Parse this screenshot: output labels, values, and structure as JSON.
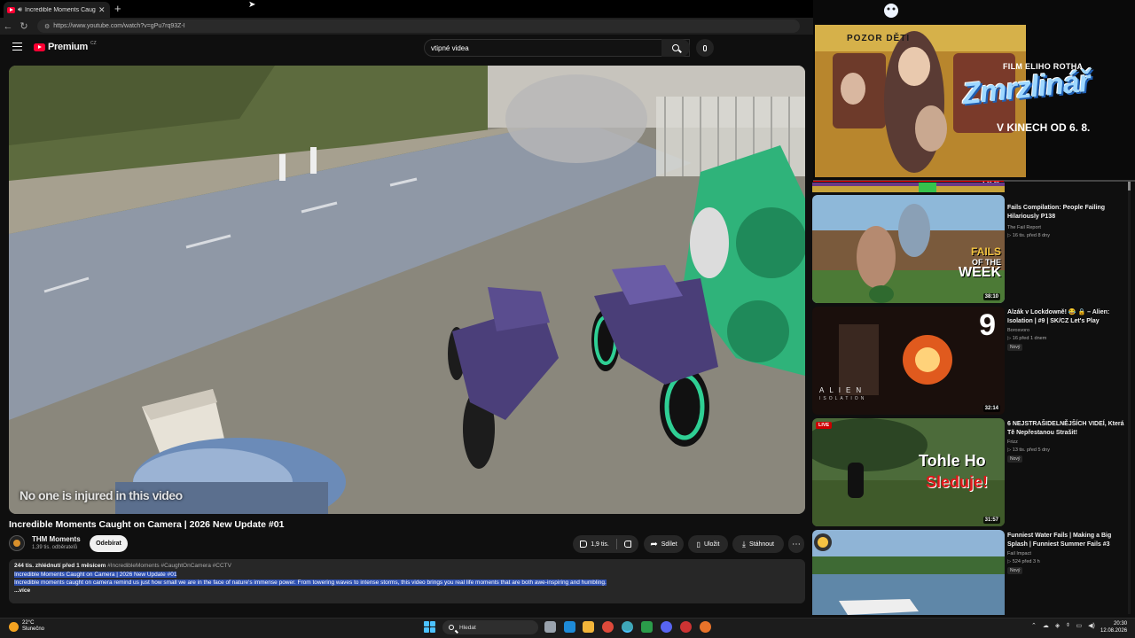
{
  "browser": {
    "tab_title": "Incredible Moments Caught on Camera",
    "new_tab_label": "+",
    "url": "https://www.youtube.com/watch?v=gPu7rq93Z-I"
  },
  "youtube": {
    "logo_text": "Premium",
    "logo_superscript": "CZ",
    "search_value": "vtipné videa"
  },
  "video": {
    "caption": "No one is injured in this video",
    "title": "Incredible Moments Caught on Camera | 2026 New Update #01",
    "channel": "THM Moments",
    "subscribers": "1,39 tis. odběratelů",
    "subscribe_label": "Odebírat",
    "likes": "1,9 tis.",
    "share_label": "Sdílet",
    "save_label": "Uložit",
    "download_label": "Stáhnout",
    "more_label": "⋯"
  },
  "description": {
    "meta": "244 tis. zhlédnutí  před 1 měsícem",
    "tags": "#IncredibleMoments #CaughtOnCamera #CCTV",
    "line1": "Incredible Moments Caught on Camera | 2026 New Update #01",
    "line2": "Incredible moments caught on camera remind us just how small we are in the face of nature's immense power. From towering waves to intense storms, this video brings you real life moments that are both awe-inspiring and humbling.",
    "more": "...více"
  },
  "ad": {
    "banner": "POZOR DĚTI",
    "line1": "FILM ELIHO ROTHA",
    "brand": "Zmrzlinář",
    "line3": "V KINECH OD 6. 8.",
    "duration": "1:01:36"
  },
  "recommendations": [
    {
      "title": "Fails Compilation: People Failing Hilariously P138",
      "channel": "The Fail Report",
      "stats": "▷ 16 tis.  před 8 dny",
      "duration": "38:10",
      "thumb_text_1": "FAILS",
      "thumb_text_2": "OF THE",
      "thumb_text_3": "WEEK",
      "badge": ""
    },
    {
      "title": "Alzák v Lockdowně! 😂 🔒 – Alien: Isolation | #9 | SK/CZ Let's Play",
      "channel": "Borosvoro",
      "stats": "▷ 16  před 1 dnem",
      "duration": "32:14",
      "thumb_text_1": "9",
      "thumb_text_2": "ALIEN",
      "thumb_text_3": "ISOLATION",
      "badge": "Nový"
    },
    {
      "title": "6 NEJSTRAŠIDELNĚJŠÍCH VIDEÍ, Která Tě Nepřestanou Strašit!",
      "channel": "Frizz",
      "stats": "▷ 13 tis.  před 5 dny",
      "duration": "31:57",
      "thumb_text_1": "Tohle Ho",
      "thumb_text_2": "Sleduje!",
      "thumb_text_3": "LIVE",
      "badge": "Nový"
    },
    {
      "title": "Funniest Water Fails | Making a Big Splash | Funniest Summer Fails #3",
      "channel": "Fail Impact",
      "stats": "▷ 524  před 3 h",
      "duration": "",
      "thumb_text_1": "",
      "thumb_text_2": "",
      "thumb_text_3": "",
      "badge": "Nový"
    }
  ],
  "taskbar": {
    "temp": "22°C",
    "weather": "Slunečno",
    "search_label": "Hledat",
    "time": "20:30",
    "date": "12.08.2026"
  }
}
